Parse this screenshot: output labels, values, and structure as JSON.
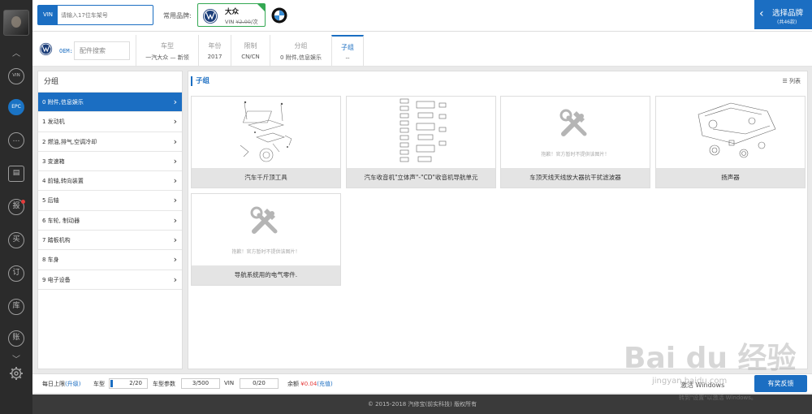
{
  "sidebar": {
    "items": [
      {
        "name": "vin",
        "label": "VIN"
      },
      {
        "name": "epc",
        "label": "EPC"
      },
      {
        "name": "chat",
        "label": "…"
      },
      {
        "name": "contacts",
        "label": "▤"
      },
      {
        "name": "report",
        "label": "报"
      },
      {
        "name": "buy",
        "label": "买"
      },
      {
        "name": "order",
        "label": "订"
      },
      {
        "name": "stock",
        "label": "库"
      },
      {
        "name": "account",
        "label": "账"
      }
    ],
    "settings_icon": "gear-icon"
  },
  "topbar": {
    "vin_label": "VIN",
    "vin_placeholder": "请输入17位车架号",
    "common_brands_label": "常用品牌:",
    "brand_name": "大众",
    "brand_price_prefix": "VIN ",
    "brand_price_old": "¥2.00",
    "brand_price_suffix": "/次",
    "select_brand": "选择品牌",
    "select_brand_count": "(共46款)"
  },
  "crumbs": {
    "oem_label": "OEM:",
    "search_placeholder": "配件搜索",
    "items": [
      {
        "h": "车型",
        "v": "一汽大众 — 新领"
      },
      {
        "h": "年份",
        "v": "2017"
      },
      {
        "h": "限制",
        "v": "CN/CN"
      },
      {
        "h": "分组",
        "v": "0 附件,信息娱乐"
      },
      {
        "h": "子组",
        "v": "--"
      }
    ]
  },
  "groups": {
    "title": "分组",
    "items": [
      "0 附件,信息娱乐",
      "1 发动机",
      "2 燃油,排气,空调冷却",
      "3 变速箱",
      "4 前轴,转向装置",
      "5 后轴",
      "6 车轮, 制动器",
      "7 踏板机构",
      "8 车身",
      "9 电子设备"
    ]
  },
  "subgroups": {
    "title": "子组",
    "view_toggle": "列表",
    "no_image_text": "抱歉！官方暂时不提供该图片！",
    "cards": [
      {
        "caption": "汽车千斤顶工具",
        "has_image": true
      },
      {
        "caption": "汽车收音机\"立体声\"-\"CD\"收音机导航单元",
        "has_image": true
      },
      {
        "caption": "车顶天线天线放大器抗干扰滤波器",
        "has_image": false
      },
      {
        "caption": "扬声器",
        "has_image": true
      },
      {
        "caption": "导航系统用的电气零件.",
        "has_image": false
      }
    ]
  },
  "status": {
    "daily_limit": "每日上限",
    "upgrade": "(升级)",
    "model_label": "车型",
    "model_value": "2/20",
    "params_label": "车型参数",
    "params_value": "3/500",
    "vin_label": "VIN",
    "vin_value": "0/20",
    "balance_label": "余额",
    "balance_value": "¥0.04",
    "recharge": "(充值)",
    "feedback": "有奖反馈"
  },
  "footer": "© 2015-2018 汽修宝(前实科技) 版权所有",
  "watermark": {
    "text": "Bai du 经验",
    "url": "jingyan.baidu.com",
    "activate": "激活 Windows",
    "activate_sub": "转到\"设置\"以激活 Windows。"
  }
}
